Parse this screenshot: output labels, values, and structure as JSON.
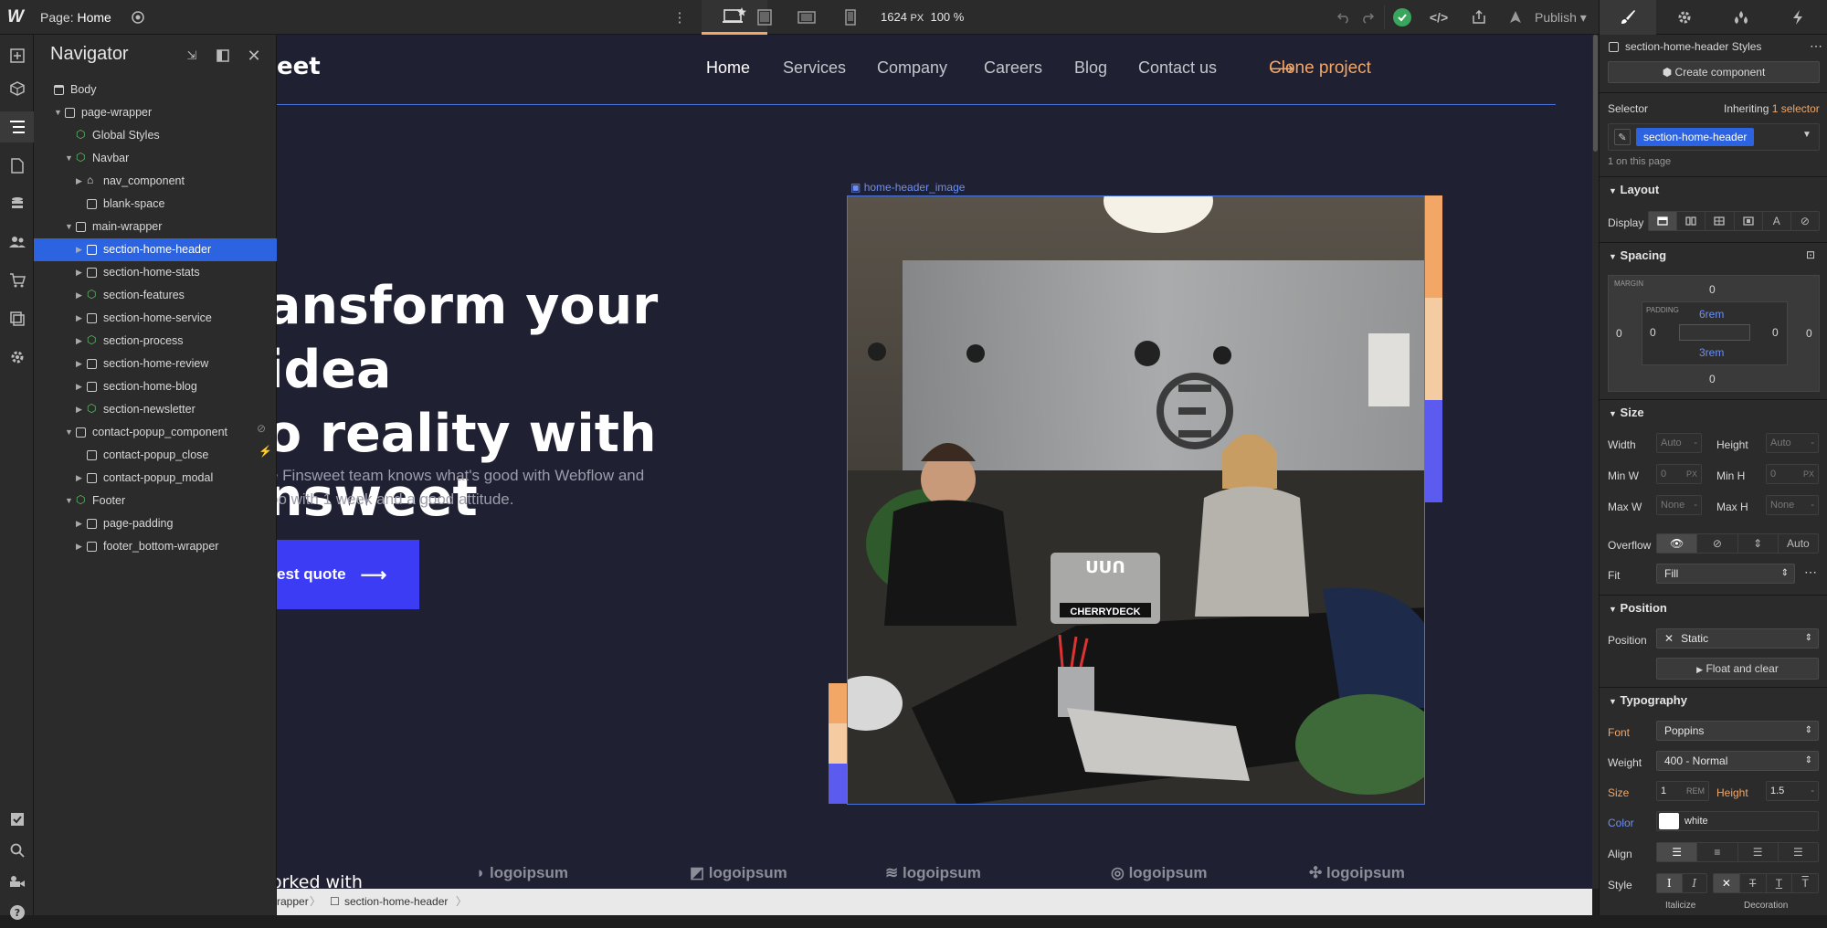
{
  "topbar": {
    "logo": "W",
    "page_label": "Page:",
    "page_name": "Home",
    "canvas_width": "1624",
    "canvas_width_unit": "PX",
    "zoom": "100 %",
    "publish": "Publish"
  },
  "navigator": {
    "title": "Navigator",
    "rows": [
      {
        "label": "Body",
        "indent": 0,
        "kind": "body",
        "caret": false,
        "selected": false
      },
      {
        "label": "page-wrapper",
        "indent": 1,
        "kind": "box",
        "caret": "open",
        "selected": false
      },
      {
        "label": "Global Styles",
        "indent": 2,
        "kind": "component",
        "caret": false,
        "selected": false
      },
      {
        "label": "Navbar",
        "indent": 2,
        "kind": "component",
        "caret": "open",
        "selected": false
      },
      {
        "label": "nav_component",
        "indent": 3,
        "kind": "home",
        "caret": "closed",
        "selected": false
      },
      {
        "label": "blank-space",
        "indent": 3,
        "kind": "box",
        "caret": false,
        "selected": false
      },
      {
        "label": "main-wrapper",
        "indent": 2,
        "kind": "box",
        "caret": "open",
        "selected": false
      },
      {
        "label": "section-home-header",
        "indent": 3,
        "kind": "box",
        "caret": "closed",
        "selected": true
      },
      {
        "label": "section-home-stats",
        "indent": 3,
        "kind": "box",
        "caret": "closed",
        "selected": false
      },
      {
        "label": "section-features",
        "indent": 3,
        "kind": "component",
        "caret": "closed",
        "selected": false
      },
      {
        "label": "section-home-service",
        "indent": 3,
        "kind": "box",
        "caret": "closed",
        "selected": false
      },
      {
        "label": "section-process",
        "indent": 3,
        "kind": "component",
        "caret": "closed",
        "selected": false
      },
      {
        "label": "section-home-review",
        "indent": 3,
        "kind": "box",
        "caret": "closed",
        "selected": false
      },
      {
        "label": "section-home-blog",
        "indent": 3,
        "kind": "box",
        "caret": "closed",
        "selected": false
      },
      {
        "label": "section-newsletter",
        "indent": 3,
        "kind": "component",
        "caret": "closed",
        "selected": false
      },
      {
        "label": "contact-popup_component",
        "indent": 2,
        "kind": "box",
        "caret": "open",
        "selected": false
      },
      {
        "label": "contact-popup_close",
        "indent": 3,
        "kind": "box",
        "caret": false,
        "selected": false
      },
      {
        "label": "contact-popup_modal",
        "indent": 3,
        "kind": "box",
        "caret": "closed",
        "selected": false
      },
      {
        "label": "Footer",
        "indent": 2,
        "kind": "component",
        "caret": "open",
        "selected": false
      },
      {
        "label": "page-padding",
        "indent": 3,
        "kind": "box",
        "caret": "closed",
        "selected": false
      },
      {
        "label": "footer_bottom-wrapper",
        "indent": 3,
        "kind": "box",
        "caret": "closed",
        "selected": false
      }
    ]
  },
  "canvas": {
    "brand_fragment": "eet",
    "nav_links": [
      "Home",
      "Services",
      "Company",
      "Careers",
      "Blog",
      "Contact us"
    ],
    "clone_link": "Clone project",
    "hero_title": "ansform your idea\no reality with\nnsweet",
    "hero_sub": "e Finsweet team knows what's good with Webflow and\noo with 1 week and a good attitude.",
    "quote_button": "est quote",
    "image_label": "home-header_image",
    "laptop_sticker": "CHERRYDECK",
    "worked_with": "orked with",
    "logos": [
      "logoipsum",
      "logoipsum",
      "logoipsum",
      "logoipsum",
      "logoipsum"
    ]
  },
  "breadcrumbs": [
    "rapper",
    "section-home-header"
  ],
  "style_panel": {
    "styles_title": "section-home-header Styles",
    "create_component": "Create component",
    "selector_label": "Selector",
    "inheriting_prefix": "Inheriting",
    "inheriting_link": "1 selector",
    "selector_chip": "section-home-header",
    "on_page": "1 on this page",
    "layout": {
      "heading": "Layout",
      "display_label": "Display"
    },
    "spacing": {
      "heading": "Spacing",
      "margin_label": "MARGIN",
      "padding_label": "PADDING",
      "margin_top": "0",
      "margin_left": "0",
      "margin_right": "0",
      "margin_bottom": "0",
      "padding_top": "6rem",
      "padding_left": "0",
      "padding_right": "0",
      "padding_bottom": "3rem"
    },
    "size": {
      "heading": "Size",
      "width_label": "Width",
      "width_value": "Auto",
      "height_label": "Height",
      "height_value": "Auto",
      "minw_label": "Min W",
      "minw_value": "0",
      "minw_unit": "PX",
      "minh_label": "Min H",
      "minh_value": "0",
      "minh_unit": "PX",
      "maxw_label": "Max W",
      "maxw_value": "None",
      "maxh_label": "Max H",
      "maxh_value": "None",
      "overflow_label": "Overflow",
      "overflow_auto": "Auto",
      "fit_label": "Fit",
      "fit_value": "Fill"
    },
    "position": {
      "heading": "Position",
      "position_label": "Position",
      "position_value": "Static",
      "float_clear": "Float and clear"
    },
    "typography": {
      "heading": "Typography",
      "font_label": "Font",
      "font_value": "Poppins",
      "weight_label": "Weight",
      "weight_value": "400 - Normal",
      "size_label": "Size",
      "size_value": "1",
      "size_unit": "REM",
      "lh_label": "Height",
      "lh_value": "1.5",
      "color_label": "Color",
      "color_value": "white",
      "color_hex": "#ffffff",
      "align_label": "Align",
      "style_label": "Style",
      "italicize_label": "Italicize",
      "decoration_label": "Decoration"
    }
  },
  "colors": {
    "accent_orange": "#f2a766",
    "selection_blue": "#2c63e0",
    "canvas_bg": "#1f2032",
    "quote_button": "#3c3cf5",
    "green_status": "#3aa55c"
  }
}
